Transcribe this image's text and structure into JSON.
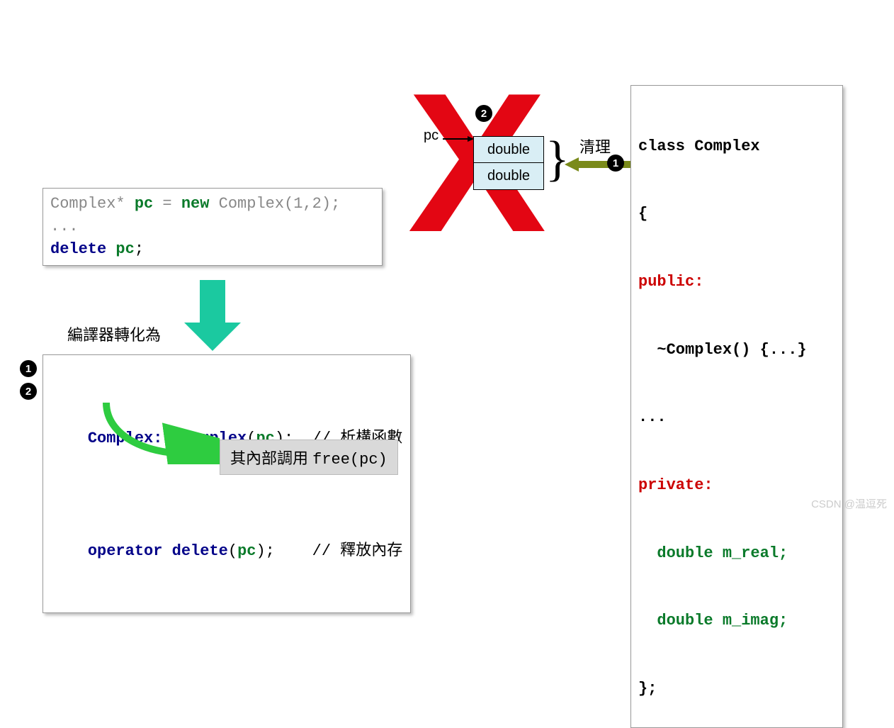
{
  "box1": {
    "line1_pre": "Complex* ",
    "line1_var": "pc",
    "line1_eq": " = ",
    "line1_new": "new",
    "line1_post": " Complex(1,2);",
    "line2": "...",
    "line3_del": "delete",
    "line3_var": " pc",
    "line3_semi": ";"
  },
  "translate_label": "編譯器轉化為",
  "box2": {
    "l1_cls": "Complex::~Complex",
    "l1_open": "(",
    "l1_arg": "pc",
    "l1_close": ");",
    "l1_cmt": "  // 析構函數",
    "l2_op": "operator",
    "l2_del": " delete",
    "l2_open": "(",
    "l2_arg": "pc",
    "l2_close": ");",
    "l2_cmt": "    // 釋放內存"
  },
  "box3": {
    "prefix": "其內部調用 ",
    "call": "free(pc)"
  },
  "memory": {
    "cell1": "double",
    "cell2": "double",
    "pc_label": "pc",
    "cleanup_label": "清理"
  },
  "badges": {
    "one": "1",
    "two": "2"
  },
  "classBox": {
    "l1": "class Complex",
    "l2": "{",
    "l3": "public:",
    "l4_a": "  ~Complex() {...}",
    "l5": "...",
    "l6": "private:",
    "l7": "  double m_real;",
    "l8": "  double m_imag;",
    "l9": "};"
  },
  "watermark": "CSDN @温逗死"
}
